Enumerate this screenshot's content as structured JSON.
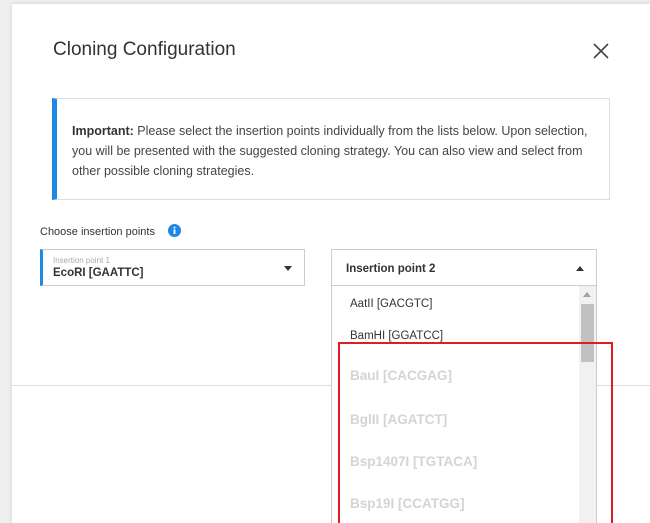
{
  "dialog": {
    "title": "Cloning Configuration",
    "close_icon": "close-icon"
  },
  "info": {
    "label": "Important:",
    "text": " Please select the insertion points individually from the lists below. Upon selection, you will be presented with the suggested cloning strategy. You can also view and select from other possible cloning strategies.",
    "accent_color": "#1e88e5"
  },
  "insertion": {
    "label": "Choose insertion points",
    "info_icon": "info-icon",
    "point1": {
      "small_label": "Insertion point 1",
      "value": "EcoRI [GAATTC]"
    },
    "point2": {
      "value": "Insertion point 2",
      "options": [
        "AatII [GACGTC]",
        "BamHI [GGATCC]",
        "BauI [CACGAG]",
        "BglII [AGATCT]",
        "Bsp1407I [TGTACA]",
        "Bsp19I [CCATGG]"
      ]
    }
  },
  "highlight_color": "#e31c23"
}
